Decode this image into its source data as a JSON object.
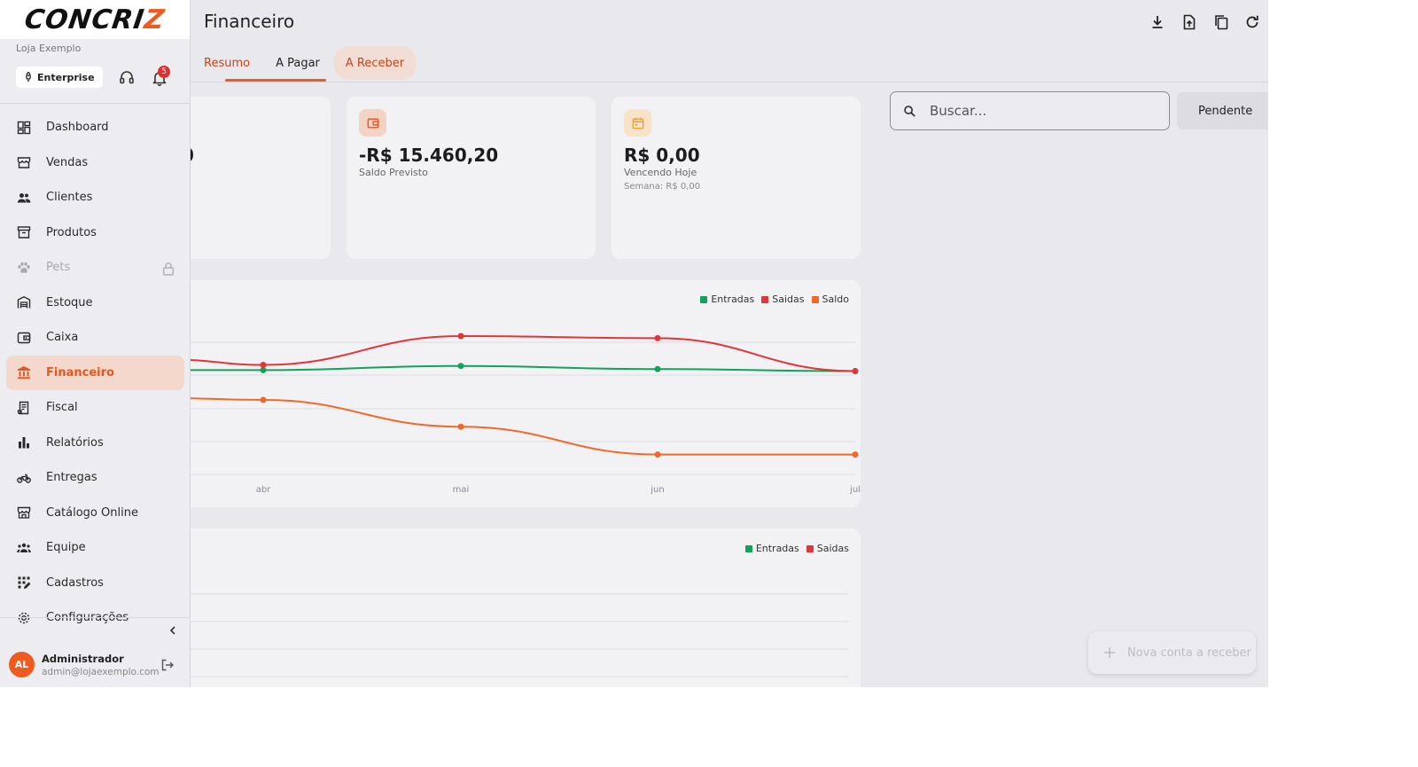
{
  "brand": {
    "logo_text": "CONCRIZ",
    "store_name": "Loja Exemplo",
    "plan": "Enterprise",
    "notifications_count": "5"
  },
  "sidebar": {
    "items": [
      {
        "label": "Dashboard",
        "icon": "dashboard-icon"
      },
      {
        "label": "Vendas",
        "icon": "store-icon"
      },
      {
        "label": "Clientes",
        "icon": "people-icon"
      },
      {
        "label": "Produtos",
        "icon": "archive-icon"
      },
      {
        "label": "Pets",
        "icon": "paw-icon",
        "locked": true
      },
      {
        "label": "Estoque",
        "icon": "warehouse-icon"
      },
      {
        "label": "Caixa",
        "icon": "wallet-icon"
      },
      {
        "label": "Financeiro",
        "icon": "bank-icon",
        "active": true
      },
      {
        "label": "Fiscal",
        "icon": "receipt-icon"
      },
      {
        "label": "Relatórios",
        "icon": "bar-chart-icon"
      },
      {
        "label": "Entregas",
        "icon": "motorcycle-icon"
      },
      {
        "label": "Catálogo Online",
        "icon": "storefront-icon"
      },
      {
        "label": "Equipe",
        "icon": "group-icon"
      },
      {
        "label": "Cadastros",
        "icon": "grid-edit-icon"
      },
      {
        "label": "Configurações",
        "icon": "gear-icon"
      }
    ],
    "user": {
      "initials": "AL",
      "name": "Administrador",
      "email": "admin@lojaexemplo.com"
    }
  },
  "header": {
    "title": "Financeiro"
  },
  "tabs": [
    {
      "label": "Resumo"
    },
    {
      "label": "A Pagar"
    },
    {
      "label": "A Receber"
    }
  ],
  "cards": [
    {
      "value": "0",
      "label": "",
      "sub": ""
    },
    {
      "value": "-R$ 15.460,20",
      "label": "Saldo Previsto",
      "sub": ""
    },
    {
      "value": "R$ 0,00",
      "label": "Vencendo Hoje",
      "sub": "Semana: R$ 0,00"
    }
  ],
  "search": {
    "placeholder": "Buscar..."
  },
  "filter": {
    "label": "Pendente"
  },
  "fab": {
    "label": "Nova conta a receber"
  },
  "colors": {
    "accent": "#ef5a1f",
    "entradas": "#10a35a",
    "saidas": "#e0363a",
    "saldo": "#ef6a2a"
  },
  "chart_data": [
    {
      "type": "line",
      "categories": [
        "abr",
        "mai",
        "jun",
        "jul"
      ],
      "legend_position": "top-right",
      "grid": true,
      "series": [
        {
          "name": "Entradas",
          "values": [
            8200,
            8600,
            8300,
            8100
          ]
        },
        {
          "name": "Saidas",
          "values": [
            8700,
            11500,
            11300,
            8100
          ]
        },
        {
          "name": "Saldo",
          "values": [
            5300,
            2700,
            0,
            0
          ]
        }
      ],
      "ylim": [
        -1500,
        14000
      ]
    },
    {
      "type": "bar",
      "legend_position": "top-right",
      "grid": true,
      "series": [
        {
          "name": "Entradas"
        },
        {
          "name": "Saidas"
        }
      ]
    }
  ]
}
